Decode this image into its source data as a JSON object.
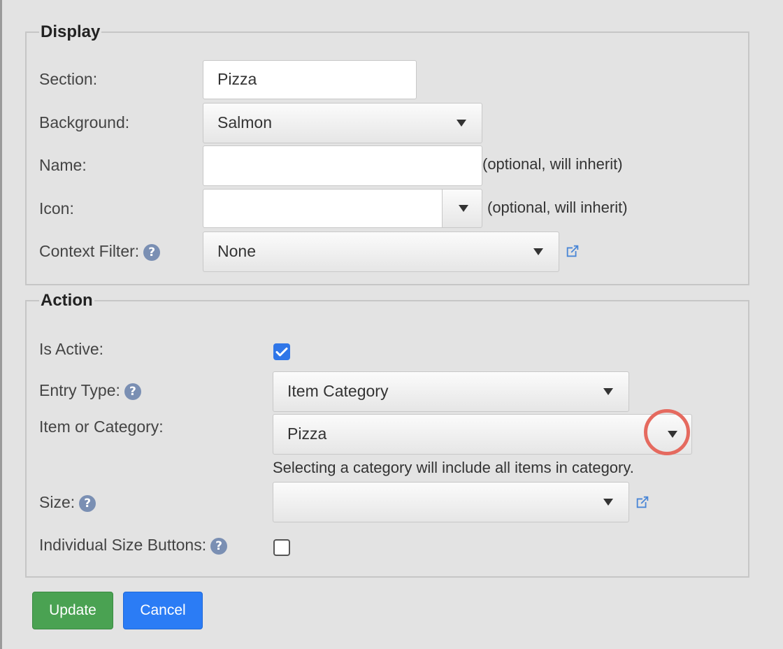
{
  "display": {
    "legend": "Display",
    "section": {
      "label": "Section:",
      "value": "Pizza"
    },
    "background": {
      "label": "Background:",
      "value": "Salmon"
    },
    "name": {
      "label": "Name:",
      "value": "",
      "note": "(optional, will inherit)"
    },
    "icon": {
      "label": "Icon:",
      "value": "",
      "note": "(optional, will inherit)"
    },
    "context_filter": {
      "label": "Context Filter:",
      "value": "None"
    }
  },
  "action": {
    "legend": "Action",
    "is_active": {
      "label": "Is Active:",
      "checked": true
    },
    "entry_type": {
      "label": "Entry Type:",
      "value": "Item Category"
    },
    "item_or_category": {
      "label": "Item or Category:",
      "value": "Pizza",
      "hint": "Selecting a category will include all items in category."
    },
    "size": {
      "label": "Size:",
      "value": ""
    },
    "individual_size_buttons": {
      "label": "Individual Size Buttons:",
      "checked": false
    }
  },
  "buttons": {
    "update": "Update",
    "cancel": "Cancel"
  },
  "icons": {
    "help": "?",
    "help_icon": "question-circle-icon",
    "external": "external-link-icon"
  },
  "colors": {
    "help": "#7a8fb3",
    "link": "#4a86d6",
    "checkbox_on": "#2f76e8",
    "update_button": "#4aa252",
    "cancel_button": "#2b7cf5",
    "highlight_circle": "#e56a5f"
  }
}
